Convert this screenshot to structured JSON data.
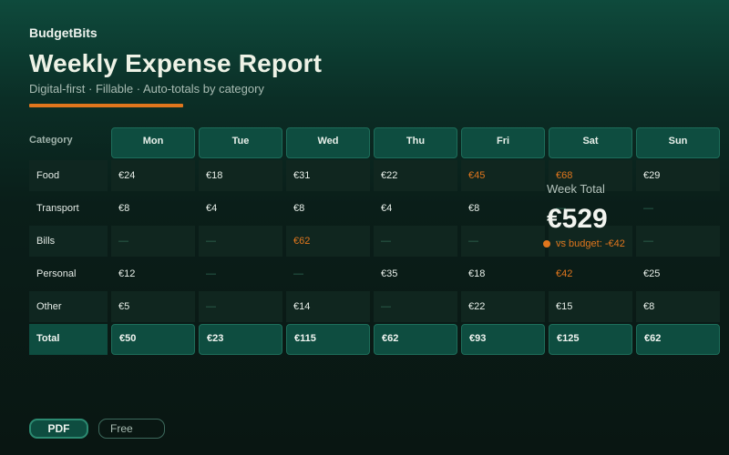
{
  "brand": "BudgetBits",
  "title": "Weekly Expense Report",
  "subtitle": "Digital-first · Fillable · Auto-totals by category",
  "colors": {
    "accent": "#e0761d",
    "header": "#0e4d40",
    "background": "#0a1e19"
  },
  "table": {
    "category_header": "Category",
    "days": [
      "Mon",
      "Tue",
      "Wed",
      "Thu",
      "Fri",
      "Sat",
      "Sun"
    ],
    "rows": [
      {
        "label": "Food",
        "values": [
          "€24",
          "€18",
          "€31",
          "€22",
          "€45",
          "€68",
          "€29"
        ]
      },
      {
        "label": "Transport",
        "values": [
          "€8",
          "€4",
          "€8",
          "€4",
          "€8",
          "—",
          "—"
        ]
      },
      {
        "label": "Bills",
        "values": [
          "—",
          "—",
          "€62",
          "—",
          "—",
          "—",
          "—"
        ]
      },
      {
        "label": "Personal",
        "values": [
          "€12",
          "—",
          "—",
          "€35",
          "€18",
          "€42",
          "€25"
        ]
      },
      {
        "label": "Other",
        "values": [
          "€5",
          "—",
          "€14",
          "—",
          "€22",
          "€15",
          "€8"
        ]
      }
    ],
    "over_budget_cells": [
      [
        0,
        4
      ],
      [
        0,
        5
      ],
      [
        2,
        2
      ],
      [
        3,
        5
      ]
    ],
    "total_label": "Total",
    "totals": [
      "€50",
      "€23",
      "€115",
      "€62",
      "€93",
      "€125",
      "€62"
    ]
  },
  "summary": {
    "label": "Week Total",
    "value": "€529",
    "budget_delta": "vs budget: -€42"
  },
  "export": {
    "pdf_label": "PDF",
    "free_label": "Free"
  }
}
